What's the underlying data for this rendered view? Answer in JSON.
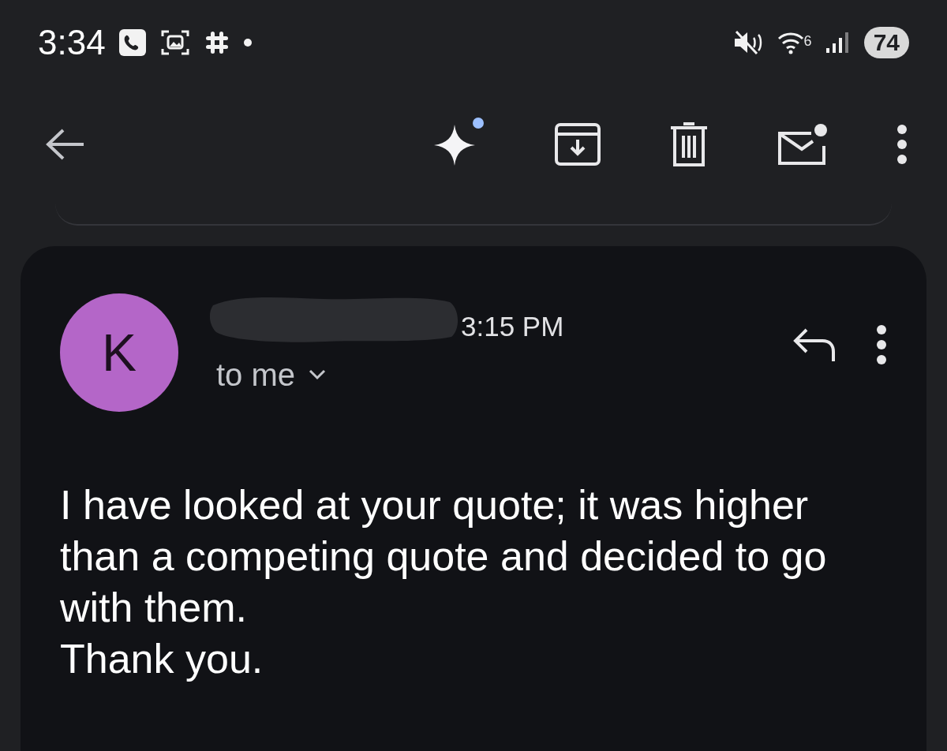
{
  "status_bar": {
    "time": "3:34",
    "network_badge": "6",
    "battery": "74"
  },
  "message": {
    "avatar_initial": "K",
    "time": "3:15 PM",
    "recipient": "to me",
    "body": [
      "I have looked at your quote; it was higher than a competing quote and decided to go with them.",
      "Thank you."
    ]
  }
}
